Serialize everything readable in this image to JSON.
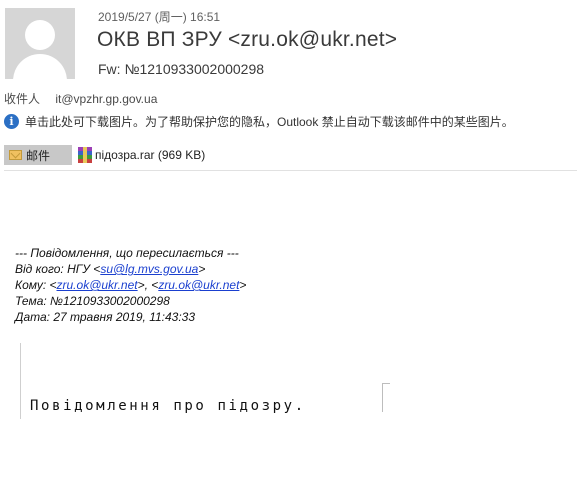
{
  "header": {
    "date": "2019/5/27 (周一) 16:51",
    "sender": "ОКВ ВП ЗРУ <zru.ok@ukr.net>",
    "subject": "Fw: №1210933002000298"
  },
  "recipients": {
    "label": "收件人",
    "value": "it@vpzhr.gp.gov.ua"
  },
  "info_bar": {
    "icon": "info-icon",
    "text": "单击此处可下载图片。为了帮助保护您的隐私，Outlook 禁止自动下载该邮件中的某些图片。"
  },
  "attachments": {
    "message_tab": "邮件",
    "file": "підозра.rar (969 KB)"
  },
  "forwarded": {
    "separator": "--- Повідомлення, що пересилається ---",
    "from_label": "Від кого: НГУ <",
    "from_email": "su@lg.mvs.gov.ua",
    "from_tail": ">",
    "to_label": "Кому: <",
    "to_email_1": "zru.ok@ukr.net",
    "to_mid": ">, <",
    "to_email_2": "zru.ok@ukr.net",
    "to_tail": ">",
    "subject_line": "Тема: №1210933002000298",
    "date_line": "Дата: 27 травня 2019, 11:43:33"
  },
  "body": {
    "notice": "Повідомлення про підозру."
  }
}
